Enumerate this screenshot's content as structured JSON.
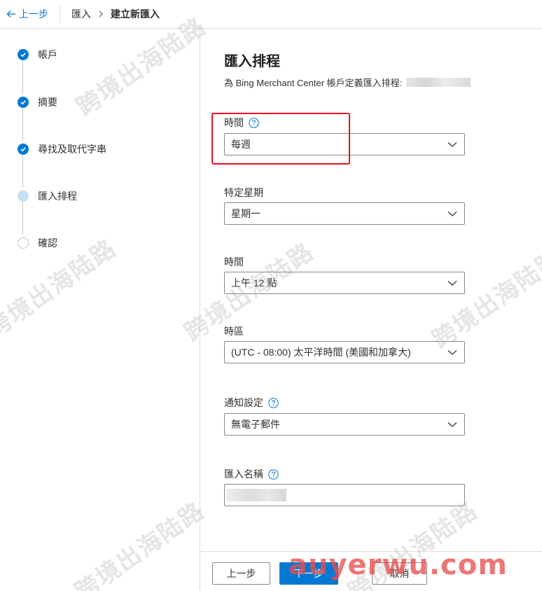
{
  "topbar": {
    "back_label": "上一步",
    "breadcrumb": [
      "匯入",
      "建立新匯入"
    ]
  },
  "steps": [
    {
      "label": "帳戶",
      "status": "done"
    },
    {
      "label": "摘要",
      "status": "done"
    },
    {
      "label": "尋找及取代字串",
      "status": "done"
    },
    {
      "label": "匯入排程",
      "status": "current"
    },
    {
      "label": "確認",
      "status": "pending"
    }
  ],
  "main": {
    "title": "匯入排程",
    "subtitle": "為 Bing Merchant Center 帳戶定義匯入排程:",
    "fields": {
      "frequency": {
        "label": "時間",
        "value": "每週"
      },
      "day_of_week": {
        "label": "特定星期",
        "value": "星期一"
      },
      "time": {
        "label": "時間",
        "value": "上午 12 點"
      },
      "time_zone": {
        "label": "時區",
        "value": "(UTC - 08:00) 太平洋時間 (美國和加拿大)"
      },
      "notification": {
        "label": "通知設定",
        "value": "無電子郵件"
      },
      "import_name": {
        "label": "匯入名稱",
        "value": ""
      }
    }
  },
  "footer": {
    "back_button": "上一步",
    "next_button": "下一步",
    "cancel_button": "取消"
  },
  "watermark": {
    "text": "跨境出海陆路",
    "url": "auyerwu.com"
  },
  "colors": {
    "accent": "#0078d4",
    "highlight": "#e81123"
  }
}
